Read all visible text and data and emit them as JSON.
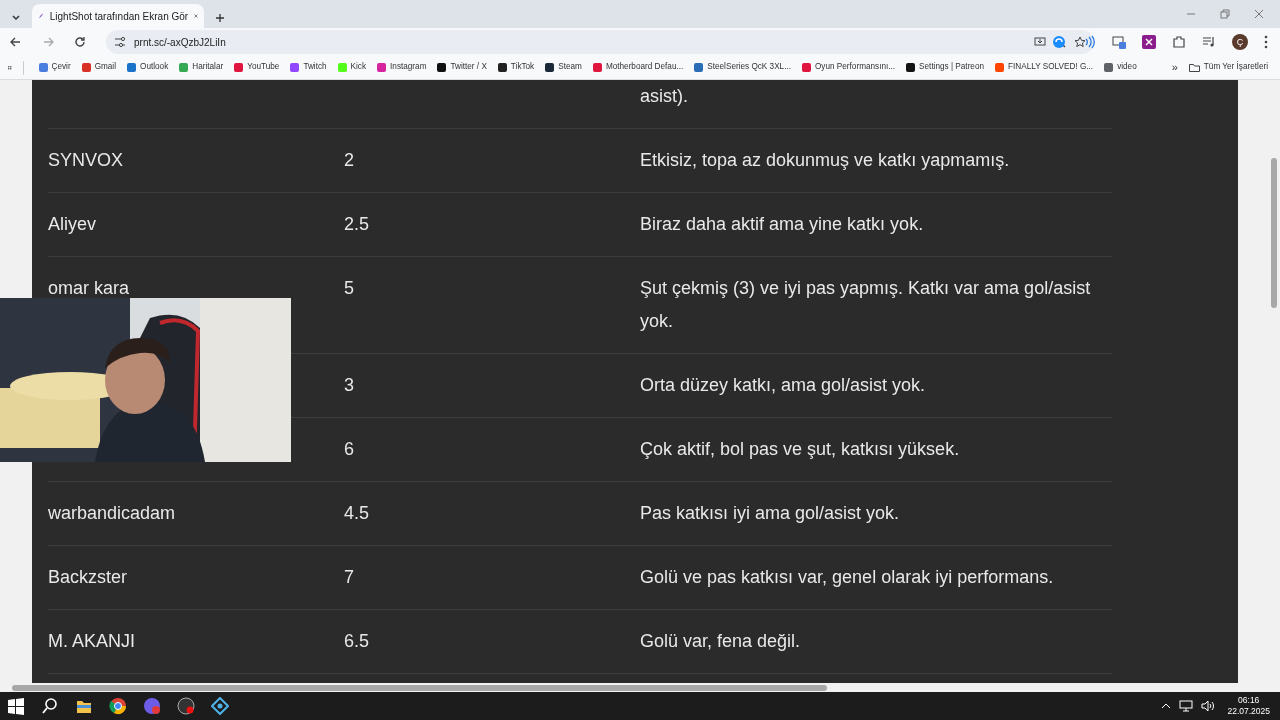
{
  "browser": {
    "tab": {
      "title": "LightShot tarafından Ekran Gör",
      "selected": true
    },
    "address": "prnt.sc/-axQzbJ2LiIn",
    "profile_initial": "Ç",
    "bookmarks": [
      {
        "label": "Çevir",
        "color": "#4a7fe0"
      },
      {
        "label": "Gmail",
        "color": "#d93025"
      },
      {
        "label": "Outlook",
        "color": "#1a73c8"
      },
      {
        "label": "Haritalar",
        "color": "#34a853"
      },
      {
        "label": "YouTube",
        "color": "#e0163f"
      },
      {
        "label": "Twitch",
        "color": "#9146ff"
      },
      {
        "label": "Kick",
        "color": "#53fc18"
      },
      {
        "label": "Instagram",
        "color": "#d6249f"
      },
      {
        "label": "Twitter / X",
        "color": "#111111"
      },
      {
        "label": "TikTok",
        "color": "#222222"
      },
      {
        "label": "Steam",
        "color": "#1b2838"
      },
      {
        "label": "Motherboard Defau...",
        "color": "#e0163f"
      },
      {
        "label": "SteelSeries QcK 3XL...",
        "color": "#2a6db5"
      },
      {
        "label": "Oyun Performansını...",
        "color": "#e0163f"
      },
      {
        "label": "Settings | Patreon",
        "color": "#141414"
      },
      {
        "label": "FINALLY SOLVED! G...",
        "color": "#ff4500"
      },
      {
        "label": "video",
        "color": "#5f6368"
      }
    ],
    "more_bookmarks": "»",
    "all_bookmarks": "Tüm Yer İşaretleri"
  },
  "table": {
    "rows": [
      {
        "note": "asist)."
      },
      {
        "player": "SYNVOX",
        "rating": "2",
        "note": "Etkisiz, topa az dokunmuş ve katkı yapmamış."
      },
      {
        "player": "Aliyev",
        "rating": "2.5",
        "note": "Biraz daha aktif ama yine katkı yok."
      },
      {
        "player": "omar kara",
        "rating": "5",
        "note": "Şut çekmiş (3) ve iyi pas yapmış. Katkı var ama gol/asist yok."
      },
      {
        "rating": "3",
        "note": "Orta düzey katkı, ama gol/asist yok."
      },
      {
        "rating": "6",
        "note": "Çok aktif, bol pas ve şut, katkısı yüksek."
      },
      {
        "player": "warbandicadam",
        "rating": "4.5",
        "note": "Pas katkısı iyi ama gol/asist yok."
      },
      {
        "player": "Backzster",
        "rating": "7",
        "note": "Golü ve pas katkısı var, genel olarak iyi performans."
      },
      {
        "player": "M. AKANJI",
        "rating": "6.5",
        "note": "Golü var, fena değil."
      }
    ]
  },
  "taskbar": {
    "time": "06:16",
    "date": "22.07.2025"
  }
}
